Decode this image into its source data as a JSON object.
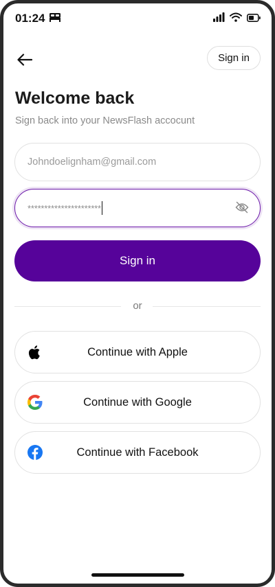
{
  "status_bar": {
    "time": "01:24"
  },
  "header": {
    "signin_label": "Sign in"
  },
  "main": {
    "title": "Welcome back",
    "subtitle": "Sign back into your NewsFlash accocunt",
    "email_value": "Johndoelignham@gmail.com",
    "password_mask": "**********************",
    "signin_button_label": "Sign in",
    "divider_text": "or"
  },
  "social": {
    "apple_label": "Continue with Apple",
    "google_label": "Continue with Google",
    "facebook_label": "Continue with Facebook"
  },
  "colors": {
    "brand": "#56039a",
    "focus_border": "#6a16a8",
    "facebook": "#1877f2"
  }
}
